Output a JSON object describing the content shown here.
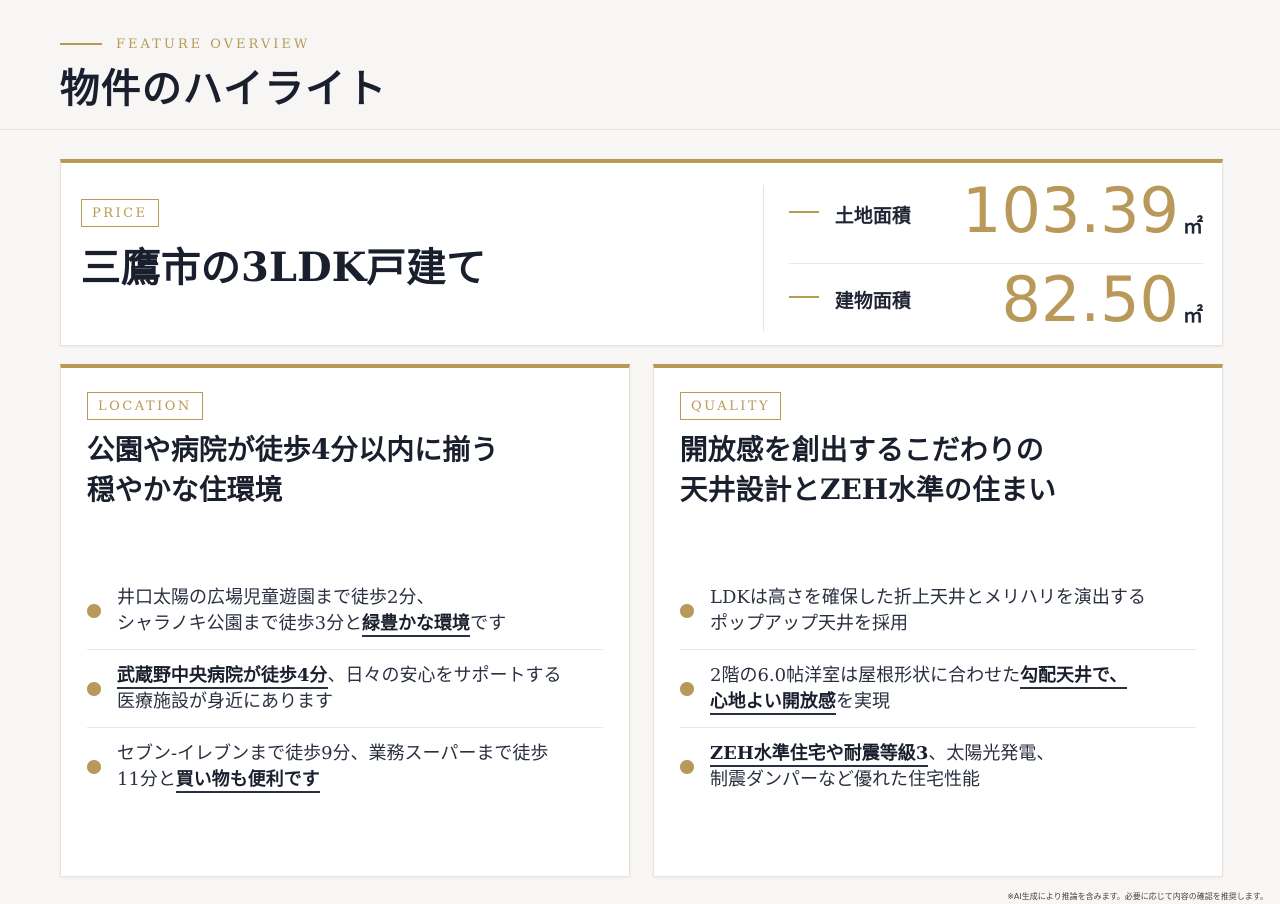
{
  "header": {
    "eyebrow": "FEATURE OVERVIEW",
    "title": "物件のハイライト"
  },
  "price": {
    "tag": "PRICE",
    "title": "三鷹市の3LDK戸建て",
    "metrics": [
      {
        "label": "土地面積",
        "value": "103.39",
        "unit": "㎡"
      },
      {
        "label": "建物面積",
        "value": "82.50",
        "unit": "㎡"
      }
    ]
  },
  "location": {
    "tag": "LOCATION",
    "title_line1": "公園や病院が徒歩4分以内に揃う",
    "title_line2": "穏やかな住環境",
    "items": [
      {
        "l1": "井口太陽の広場児童遊園まで徒歩2分、",
        "l2_pre": "シャラノキ公園まで徒歩3分と",
        "l2_em": "緑豊かな環境",
        "l2_post": "です"
      },
      {
        "l1_em": "武蔵野中央病院が徒歩4分",
        "l1_post": "、日々の安心をサポートする",
        "l2": "医療施設が身近にあります"
      },
      {
        "l1": "セブン-イレブンまで徒歩9分、業務スーパーまで徒歩",
        "l2_pre": "11分と",
        "l2_em": "買い物も便利です"
      }
    ]
  },
  "quality": {
    "tag": "QUALITY",
    "title_line1": "開放感を創出するこだわりの",
    "title_line2": "天井設計とZEH水準の住まい",
    "items": [
      {
        "l1": "LDKは高さを確保した折上天井とメリハリを演出する",
        "l2": "ポップアップ天井を採用"
      },
      {
        "l1_pre": "2階の6.0帖洋室は屋根形状に合わせた",
        "l1_em": "勾配天井で、",
        "l2_em": "心地よい開放感",
        "l2_post": "を実現"
      },
      {
        "l1_em": "ZEH水準住宅や耐震等級3",
        "l1_post": "、太陽光発電、",
        "l2": "制震ダンパーなど優れた住宅性能"
      }
    ]
  },
  "footnote": "※AI生成により推論を含みます。必要に応じて内容の確認を推奨します。",
  "colors": {
    "accent": "#b89a56",
    "text": "#1a1f2e",
    "background": "#f8f7f5"
  }
}
